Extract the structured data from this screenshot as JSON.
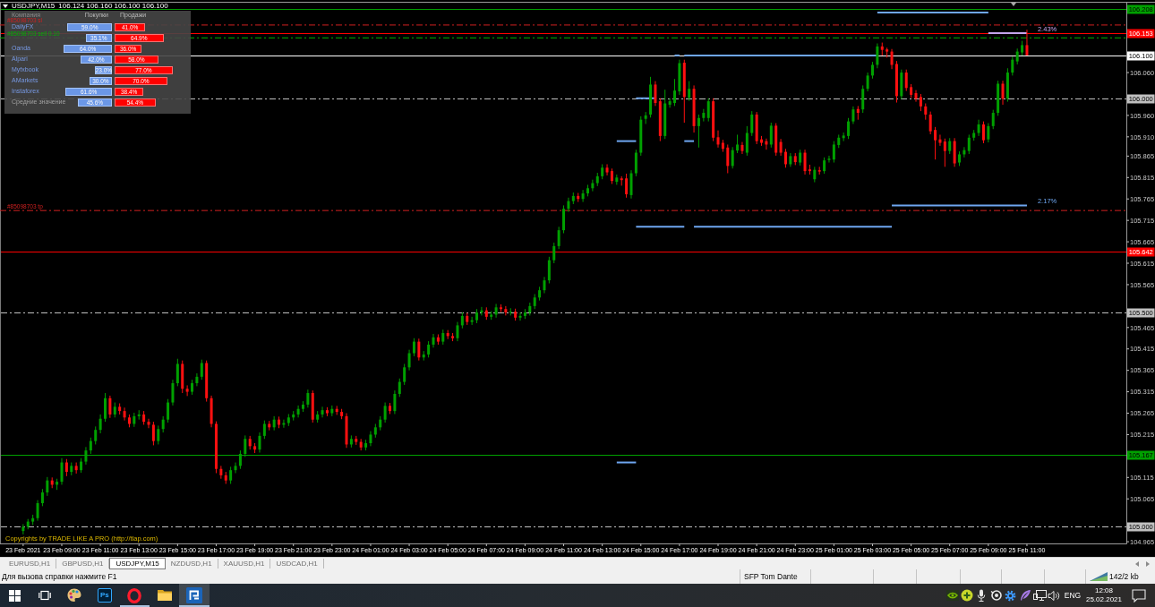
{
  "chart_window": {
    "title": "USDJPY,M15",
    "quote": "106.124 106.160 106.100 106.100",
    "sentiment": {
      "headers": [
        "Компания",
        "Покупки",
        "Продажи"
      ],
      "rows": [
        {
          "kind": "broker",
          "company": "DailyFX",
          "buy": "59.0%",
          "sell": "41.0%"
        },
        {
          "kind": "broker",
          "buy": "35.1%",
          "sell": "64.9%"
        },
        {
          "kind": "broker",
          "company": "Oanda",
          "buy": "64.0%",
          "sell": "36.0%"
        },
        {
          "kind": "broker",
          "company": "Alpari",
          "buy": "42.0%",
          "sell": "58.0%"
        },
        {
          "kind": "broker",
          "company": "Myfxbook",
          "buy": "23.0%",
          "sell": "77.0%"
        },
        {
          "kind": "broker",
          "company": "AMarkets",
          "buy": "30.0%",
          "sell": "70.0%"
        },
        {
          "kind": "broker",
          "company": "Instaforex",
          "buy": "61.6%",
          "sell": "38.4%"
        },
        {
          "kind": "average",
          "company": "Средние значение",
          "buy": "45.6%",
          "sell": "54.4%"
        }
      ]
    },
    "copyright": "Copyrights by TRADE LIKE A PRO (http://tlap.com)",
    "chart_data": {
      "type": "candlestick",
      "x": [
        "2021-02-23T07:00",
        "2021-02-23T07:15",
        "2021-02-23T07:30",
        "2021-02-23T07:45",
        "2021-02-23T08:00",
        "2021-02-23T08:15",
        "2021-02-23T08:30",
        "2021-02-23T08:45",
        "2021-02-23T09:00",
        "2021-02-23T09:15",
        "2021-02-23T09:30",
        "2021-02-23T09:45",
        "2021-02-23T10:00",
        "2021-02-23T10:15",
        "2021-02-23T10:30",
        "2021-02-23T10:45",
        "2021-02-23T11:00",
        "2021-02-23T11:15",
        "2021-02-23T11:30",
        "2021-02-23T11:45",
        "2021-02-23T12:00",
        "2021-02-23T12:15",
        "2021-02-23T12:30",
        "2021-02-23T12:45",
        "2021-02-23T13:00",
        "2021-02-23T13:15",
        "2021-02-23T13:30",
        "2021-02-23T13:45",
        "2021-02-23T14:00",
        "2021-02-23T14:15",
        "2021-02-23T14:30",
        "2021-02-23T14:45",
        "2021-02-23T15:00",
        "2021-02-23T15:15",
        "2021-02-23T15:30",
        "2021-02-23T15:45",
        "2021-02-23T16:00",
        "2021-02-23T16:15",
        "2021-02-23T16:30",
        "2021-02-23T16:45",
        "2021-02-23T17:00",
        "2021-02-23T17:15",
        "2021-02-23T17:30",
        "2021-02-23T17:45",
        "2021-02-23T18:00",
        "2021-02-23T18:15",
        "2021-02-23T18:30",
        "2021-02-23T18:45",
        "2021-02-23T19:00",
        "2021-02-23T19:15",
        "2021-02-23T19:30",
        "2021-02-23T19:45",
        "2021-02-23T20:00",
        "2021-02-23T20:15",
        "2021-02-23T20:30",
        "2021-02-23T20:45",
        "2021-02-23T21:00",
        "2021-02-23T21:15",
        "2021-02-23T21:30",
        "2021-02-23T21:45",
        "2021-02-23T22:00",
        "2021-02-23T22:15",
        "2021-02-23T22:30",
        "2021-02-23T22:45",
        "2021-02-23T23:00",
        "2021-02-23T23:15",
        "2021-02-23T23:30",
        "2021-02-23T23:45",
        "2021-02-24T00:00",
        "2021-02-24T00:15",
        "2021-02-24T00:30",
        "2021-02-24T00:45",
        "2021-02-24T01:00",
        "2021-02-24T01:15",
        "2021-02-24T01:30",
        "2021-02-24T01:45",
        "2021-02-24T02:00",
        "2021-02-24T02:15",
        "2021-02-24T02:30",
        "2021-02-24T02:45",
        "2021-02-24T03:00",
        "2021-02-24T03:15",
        "2021-02-24T03:30",
        "2021-02-24T03:45",
        "2021-02-24T04:00",
        "2021-02-24T04:15",
        "2021-02-24T04:30",
        "2021-02-24T04:45",
        "2021-02-24T05:00",
        "2021-02-24T05:15",
        "2021-02-24T05:30",
        "2021-02-24T05:45",
        "2021-02-24T06:00",
        "2021-02-24T06:15",
        "2021-02-24T06:30",
        "2021-02-24T06:45",
        "2021-02-24T07:00",
        "2021-02-24T07:15",
        "2021-02-24T07:30",
        "2021-02-24T07:45",
        "2021-02-24T08:00",
        "2021-02-24T08:15",
        "2021-02-24T08:30",
        "2021-02-24T08:45",
        "2021-02-24T09:00",
        "2021-02-24T09:15",
        "2021-02-24T09:30",
        "2021-02-24T09:45",
        "2021-02-24T10:00",
        "2021-02-24T10:15",
        "2021-02-24T10:30",
        "2021-02-24T10:45",
        "2021-02-24T11:00",
        "2021-02-24T11:15",
        "2021-02-24T11:30",
        "2021-02-24T11:45",
        "2021-02-24T12:00",
        "2021-02-24T12:15",
        "2021-02-24T12:30",
        "2021-02-24T12:45",
        "2021-02-24T13:00",
        "2021-02-24T13:15",
        "2021-02-24T13:30",
        "2021-02-24T13:45",
        "2021-02-24T14:00",
        "2021-02-24T14:15",
        "2021-02-24T14:30",
        "2021-02-24T14:45",
        "2021-02-24T15:00",
        "2021-02-24T15:15",
        "2021-02-24T15:30",
        "2021-02-24T15:45",
        "2021-02-24T16:00",
        "2021-02-24T16:15",
        "2021-02-24T16:30",
        "2021-02-24T16:45",
        "2021-02-24T17:00",
        "2021-02-24T17:15",
        "2021-02-24T17:30",
        "2021-02-24T17:45",
        "2021-02-24T18:00",
        "2021-02-24T18:15",
        "2021-02-24T18:30",
        "2021-02-24T18:45",
        "2021-02-24T19:00",
        "2021-02-24T19:15",
        "2021-02-24T19:30",
        "2021-02-24T19:45",
        "2021-02-24T20:00",
        "2021-02-24T20:15",
        "2021-02-24T20:30",
        "2021-02-24T20:45",
        "2021-02-24T21:00",
        "2021-02-24T21:15",
        "2021-02-24T21:30",
        "2021-02-24T21:45",
        "2021-02-24T22:00",
        "2021-02-24T22:15",
        "2021-02-24T22:30",
        "2021-02-24T22:45",
        "2021-02-24T23:00",
        "2021-02-24T23:15",
        "2021-02-24T23:30",
        "2021-02-24T23:45",
        "2021-02-25T00:00",
        "2021-02-25T00:15",
        "2021-02-25T00:30",
        "2021-02-25T00:45",
        "2021-02-25T01:00",
        "2021-02-25T01:15",
        "2021-02-25T01:30",
        "2021-02-25T01:45",
        "2021-02-25T02:00",
        "2021-02-25T02:15",
        "2021-02-25T02:30",
        "2021-02-25T02:45",
        "2021-02-25T03:00",
        "2021-02-25T03:15",
        "2021-02-25T03:30",
        "2021-02-25T03:45",
        "2021-02-25T04:00",
        "2021-02-25T04:15",
        "2021-02-25T04:30",
        "2021-02-25T04:45",
        "2021-02-25T05:00",
        "2021-02-25T05:15",
        "2021-02-25T05:30",
        "2021-02-25T05:45",
        "2021-02-25T06:00",
        "2021-02-25T06:15",
        "2021-02-25T06:30",
        "2021-02-25T06:45",
        "2021-02-25T07:00",
        "2021-02-25T07:15",
        "2021-02-25T07:30",
        "2021-02-25T07:45",
        "2021-02-25T08:00",
        "2021-02-25T08:15",
        "2021-02-25T08:30",
        "2021-02-25T08:45",
        "2021-02-25T09:00",
        "2021-02-25T09:15",
        "2021-02-25T09:30",
        "2021-02-25T09:45",
        "2021-02-25T10:00",
        "2021-02-25T10:15",
        "2021-02-25T10:30",
        "2021-02-25T10:45",
        "2021-02-25T11:00"
      ],
      "ohlc": [
        [
          104.99,
          105.006,
          104.982,
          105.0
        ],
        [
          105.0,
          105.018,
          104.994,
          105.012
        ],
        [
          105.012,
          105.028,
          105.004,
          105.02
        ],
        [
          105.02,
          105.062,
          105.014,
          105.055
        ],
        [
          105.055,
          105.088,
          105.048,
          105.08
        ],
        [
          105.08,
          105.116,
          105.072,
          105.108
        ],
        [
          105.108,
          105.115,
          105.09,
          105.098
        ],
        [
          105.098,
          105.112,
          105.086,
          105.105
        ],
        [
          105.105,
          105.16,
          105.098,
          105.15
        ],
        [
          105.15,
          105.158,
          105.118,
          105.128
        ],
        [
          105.128,
          105.15,
          105.12,
          105.142
        ],
        [
          105.142,
          105.15,
          105.124,
          105.132
        ],
        [
          105.132,
          105.16,
          105.126,
          105.152
        ],
        [
          105.152,
          105.186,
          105.145,
          105.178
        ],
        [
          105.178,
          105.208,
          105.17,
          105.2
        ],
        [
          105.2,
          105.234,
          105.192,
          105.226
        ],
        [
          105.226,
          105.262,
          105.218,
          105.252
        ],
        [
          105.252,
          105.312,
          105.245,
          105.3
        ],
        [
          105.3,
          105.306,
          105.254,
          105.262
        ],
        [
          105.262,
          105.29,
          105.255,
          105.28
        ],
        [
          105.28,
          105.288,
          105.262,
          105.27
        ],
        [
          105.27,
          105.278,
          105.248,
          105.255
        ],
        [
          105.255,
          105.262,
          105.232,
          105.24
        ],
        [
          105.24,
          105.266,
          105.233,
          105.258
        ],
        [
          105.258,
          105.272,
          105.25,
          105.262
        ],
        [
          105.262,
          105.27,
          105.238,
          105.245
        ],
        [
          105.245,
          105.252,
          105.23,
          105.238
        ],
        [
          105.238,
          105.245,
          105.19,
          105.2
        ],
        [
          105.2,
          105.236,
          105.192,
          105.228
        ],
        [
          105.228,
          105.258,
          105.22,
          105.25
        ],
        [
          105.25,
          105.298,
          105.243,
          105.29
        ],
        [
          105.29,
          105.343,
          105.283,
          105.335
        ],
        [
          105.335,
          105.392,
          105.328,
          105.38
        ],
        [
          105.38,
          105.388,
          105.312,
          105.322
        ],
        [
          105.322,
          105.33,
          105.305,
          105.315
        ],
        [
          105.315,
          105.343,
          105.308,
          105.335
        ],
        [
          105.335,
          105.358,
          105.328,
          105.35
        ],
        [
          105.35,
          105.39,
          105.343,
          105.382
        ],
        [
          105.382,
          105.388,
          105.292,
          105.3
        ],
        [
          105.3,
          105.306,
          105.232,
          105.24
        ],
        [
          105.24,
          105.246,
          105.125,
          105.135
        ],
        [
          105.135,
          105.142,
          105.112,
          105.12
        ],
        [
          105.12,
          105.128,
          105.1,
          105.108
        ],
        [
          105.108,
          105.14,
          105.1,
          105.132
        ],
        [
          105.132,
          105.15,
          105.125,
          105.142
        ],
        [
          105.142,
          105.178,
          105.135,
          105.17
        ],
        [
          105.17,
          105.213,
          105.163,
          105.205
        ],
        [
          105.205,
          105.212,
          105.18,
          105.188
        ],
        [
          105.188,
          105.195,
          105.172,
          105.18
        ],
        [
          105.18,
          105.22,
          105.173,
          105.212
        ],
        [
          105.212,
          105.248,
          105.205,
          105.24
        ],
        [
          105.24,
          105.247,
          105.225,
          105.232
        ],
        [
          105.232,
          105.258,
          105.225,
          105.25
        ],
        [
          105.25,
          105.257,
          105.23,
          105.238
        ],
        [
          105.238,
          105.25,
          105.231,
          105.242
        ],
        [
          105.242,
          105.263,
          105.235,
          105.255
        ],
        [
          105.255,
          105.27,
          105.248,
          105.262
        ],
        [
          105.262,
          105.283,
          105.255,
          105.275
        ],
        [
          105.275,
          105.293,
          105.268,
          105.285
        ],
        [
          105.285,
          105.32,
          105.278,
          105.312
        ],
        [
          105.312,
          105.318,
          105.243,
          105.25
        ],
        [
          105.25,
          105.27,
          105.243,
          105.262
        ],
        [
          105.262,
          105.28,
          105.255,
          105.272
        ],
        [
          105.272,
          105.279,
          105.258,
          105.265
        ],
        [
          105.265,
          105.283,
          105.258,
          105.275
        ],
        [
          105.275,
          105.282,
          105.261,
          105.268
        ],
        [
          105.268,
          105.275,
          105.251,
          105.258
        ],
        [
          105.258,
          105.265,
          105.184,
          105.192
        ],
        [
          105.192,
          105.213,
          105.185,
          105.205
        ],
        [
          105.205,
          105.212,
          105.191,
          105.198
        ],
        [
          105.198,
          105.205,
          105.178,
          105.185
        ],
        [
          105.185,
          105.203,
          105.178,
          105.195
        ],
        [
          105.195,
          105.223,
          105.188,
          105.215
        ],
        [
          105.215,
          105.24,
          105.208,
          105.232
        ],
        [
          105.232,
          105.258,
          105.225,
          105.25
        ],
        [
          105.25,
          105.29,
          105.243,
          105.282
        ],
        [
          105.282,
          105.289,
          105.263,
          105.27
        ],
        [
          105.27,
          105.318,
          105.263,
          105.31
        ],
        [
          105.31,
          105.346,
          105.303,
          105.338
        ],
        [
          105.338,
          105.38,
          105.331,
          105.372
        ],
        [
          105.372,
          105.413,
          105.365,
          105.405
        ],
        [
          105.405,
          105.44,
          105.398,
          105.432
        ],
        [
          105.432,
          105.439,
          105.388,
          105.395
        ],
        [
          105.395,
          105.41,
          105.388,
          105.402
        ],
        [
          105.402,
          105.433,
          105.395,
          105.425
        ],
        [
          105.425,
          105.45,
          105.418,
          105.442
        ],
        [
          105.442,
          105.449,
          105.425,
          105.432
        ],
        [
          105.432,
          105.46,
          105.425,
          105.452
        ],
        [
          105.452,
          105.459,
          105.438,
          105.445
        ],
        [
          105.445,
          105.452,
          105.433,
          105.44
        ],
        [
          105.44,
          105.478,
          105.433,
          105.47
        ],
        [
          105.47,
          105.5,
          105.463,
          105.492
        ],
        [
          105.492,
          105.499,
          105.471,
          105.478
        ],
        [
          105.478,
          105.49,
          105.471,
          105.482
        ],
        [
          105.482,
          105.508,
          105.475,
          105.5
        ],
        [
          105.5,
          105.513,
          105.493,
          105.505
        ],
        [
          105.505,
          105.512,
          105.483,
          105.49
        ],
        [
          105.49,
          105.503,
          105.483,
          105.495
        ],
        [
          105.495,
          105.52,
          105.488,
          105.512
        ],
        [
          105.512,
          105.519,
          105.501,
          105.508
        ],
        [
          105.508,
          105.515,
          105.493,
          105.5
        ],
        [
          105.5,
          105.51,
          105.493,
          105.502
        ],
        [
          105.502,
          105.509,
          105.481,
          105.488
        ],
        [
          105.488,
          105.5,
          105.481,
          105.492
        ],
        [
          105.492,
          105.508,
          105.485,
          105.5
        ],
        [
          105.5,
          105.523,
          105.493,
          105.515
        ],
        [
          105.515,
          105.543,
          105.508,
          105.535
        ],
        [
          105.535,
          105.56,
          105.528,
          105.552
        ],
        [
          105.552,
          105.583,
          105.545,
          105.575
        ],
        [
          105.575,
          105.63,
          105.568,
          105.622
        ],
        [
          105.622,
          105.663,
          105.615,
          105.655
        ],
        [
          105.655,
          105.7,
          105.648,
          105.692
        ],
        [
          105.692,
          105.75,
          105.685,
          105.742
        ],
        [
          105.742,
          105.768,
          105.735,
          105.76
        ],
        [
          105.76,
          105.78,
          105.753,
          105.772
        ],
        [
          105.772,
          105.779,
          105.758,
          105.765
        ],
        [
          105.765,
          105.786,
          105.758,
          105.778
        ],
        [
          105.778,
          105.798,
          105.771,
          105.79
        ],
        [
          105.79,
          105.81,
          105.783,
          105.802
        ],
        [
          105.802,
          105.826,
          105.795,
          105.818
        ],
        [
          105.818,
          105.846,
          105.811,
          105.838
        ],
        [
          105.838,
          105.846,
          105.82,
          105.827
        ],
        [
          105.83,
          105.836,
          105.8,
          105.807
        ],
        [
          105.805,
          105.822,
          105.798,
          105.815
        ],
        [
          105.813,
          105.818,
          105.796,
          105.809
        ],
        [
          105.813,
          105.824,
          105.768,
          105.776
        ],
        [
          105.774,
          105.832,
          105.766,
          105.825
        ],
        [
          105.825,
          105.88,
          105.818,
          105.873
        ],
        [
          105.873,
          105.958,
          105.866,
          105.95
        ],
        [
          105.952,
          105.968,
          105.94,
          105.96
        ],
        [
          105.962,
          106.05,
          105.955,
          106.032
        ],
        [
          106.032,
          106.04,
          105.982,
          105.989
        ],
        [
          105.993,
          106.0,
          105.9,
          105.912
        ],
        [
          105.912,
          106.02,
          105.905,
          105.988
        ],
        [
          105.985,
          106.0,
          105.978,
          105.993
        ],
        [
          105.989,
          106.045,
          105.982,
          106.018
        ],
        [
          106.016,
          106.09,
          106.008,
          106.082
        ],
        [
          106.083,
          106.09,
          105.943,
          106.003
        ],
        [
          106.001,
          106.04,
          105.994,
          106.022
        ],
        [
          106.022,
          106.03,
          105.92,
          105.935
        ],
        [
          105.935,
          105.962,
          105.885,
          105.954
        ],
        [
          105.954,
          105.975,
          105.946,
          105.966
        ],
        [
          105.954,
          106.0,
          105.946,
          105.993
        ],
        [
          105.993,
          106.0,
          105.9,
          105.908
        ],
        [
          105.909,
          105.925,
          105.885,
          105.892
        ],
        [
          105.896,
          105.903,
          105.875,
          105.882
        ],
        [
          105.885,
          105.892,
          105.825,
          105.842
        ],
        [
          105.842,
          105.886,
          105.836,
          105.879
        ],
        [
          105.878,
          105.915,
          105.872,
          105.892
        ],
        [
          105.891,
          105.898,
          105.87,
          105.877
        ],
        [
          105.873,
          105.935,
          105.866,
          105.919
        ],
        [
          105.919,
          105.97,
          105.912,
          105.962
        ],
        [
          105.962,
          105.968,
          105.893,
          105.9
        ],
        [
          105.904,
          105.912,
          105.889,
          105.896
        ],
        [
          105.9,
          105.906,
          105.88,
          105.892
        ],
        [
          105.892,
          105.943,
          105.885,
          105.936
        ],
        [
          105.936,
          105.942,
          105.866,
          105.873
        ],
        [
          105.898,
          105.905,
          105.866,
          105.873
        ],
        [
          105.875,
          105.882,
          105.838,
          105.846
        ],
        [
          105.846,
          105.872,
          105.84,
          105.865
        ],
        [
          105.865,
          105.872,
          105.844,
          105.851
        ],
        [
          105.85,
          105.88,
          105.843,
          105.873
        ],
        [
          105.873,
          105.88,
          105.822,
          105.83
        ],
        [
          105.834,
          105.845,
          105.822,
          105.83
        ],
        [
          105.811,
          105.84,
          105.804,
          105.833
        ],
        [
          105.832,
          105.84,
          105.822,
          105.829
        ],
        [
          105.83,
          105.862,
          105.824,
          105.855
        ],
        [
          105.856,
          105.866,
          105.85,
          105.859
        ],
        [
          105.857,
          105.9,
          105.85,
          105.892
        ],
        [
          105.891,
          105.915,
          105.884,
          105.908
        ],
        [
          105.907,
          105.92,
          105.9,
          105.913
        ],
        [
          105.912,
          105.954,
          105.905,
          105.946
        ],
        [
          105.946,
          105.981,
          105.94,
          105.974
        ],
        [
          105.975,
          105.982,
          105.95,
          105.966
        ],
        [
          105.974,
          106.03,
          105.966,
          106.022
        ],
        [
          106.022,
          106.06,
          106.016,
          106.053
        ],
        [
          106.053,
          106.085,
          106.046,
          106.078
        ],
        [
          106.078,
          106.128,
          106.07,
          106.121
        ],
        [
          106.121,
          106.13,
          106.1,
          106.113
        ],
        [
          106.114,
          106.118,
          106.095,
          106.109
        ],
        [
          106.109,
          106.115,
          106.068,
          106.078
        ],
        [
          106.08,
          106.087,
          105.99,
          106.005
        ],
        [
          106.005,
          106.067,
          105.998,
          106.06
        ],
        [
          106.06,
          106.067,
          106.017,
          106.024
        ],
        [
          106.026,
          106.033,
          106.001,
          106.008
        ],
        [
          106.012,
          106.019,
          105.992,
          105.999
        ],
        [
          106.003,
          106.01,
          105.97,
          105.981
        ],
        [
          105.981,
          105.988,
          105.95,
          105.962
        ],
        [
          105.962,
          105.969,
          105.916,
          105.923
        ],
        [
          105.926,
          105.933,
          105.857,
          105.902
        ],
        [
          105.904,
          105.915,
          105.889,
          105.896
        ],
        [
          105.899,
          105.906,
          105.84,
          105.877
        ],
        [
          105.877,
          105.907,
          105.87,
          105.9
        ],
        [
          105.9,
          105.907,
          105.84,
          105.848
        ],
        [
          105.85,
          105.876,
          105.842,
          105.869
        ],
        [
          105.869,
          105.886,
          105.862,
          105.879
        ],
        [
          105.877,
          105.915,
          105.87,
          105.908
        ],
        [
          105.908,
          105.926,
          105.901,
          105.919
        ],
        [
          105.919,
          105.95,
          105.912,
          105.939
        ],
        [
          105.939,
          105.946,
          105.895,
          105.902
        ],
        [
          105.904,
          105.942,
          105.897,
          105.935
        ],
        [
          105.935,
          105.973,
          105.928,
          105.966
        ],
        [
          105.966,
          106.041,
          105.959,
          106.034
        ],
        [
          106.034,
          106.041,
          105.985,
          105.999
        ],
        [
          105.999,
          106.07,
          105.992,
          106.06
        ],
        [
          106.06,
          106.097,
          106.053,
          106.09
        ],
        [
          106.086,
          106.116,
          106.079,
          106.109
        ],
        [
          106.107,
          106.134,
          106.1,
          106.124
        ],
        [
          106.124,
          106.16,
          106.1,
          106.1
        ]
      ],
      "xlim": [
        "2021-02-23T05:48",
        "2021-02-25T16:09"
      ],
      "xticks": [
        {
          "value": "2021-02-23T07:00",
          "label": "23 Feb 2021"
        },
        {
          "value": "2021-02-23T09:00",
          "label": "23 Feb 09:00"
        },
        {
          "value": "2021-02-23T11:00",
          "label": "23 Feb 11:00"
        },
        {
          "value": "2021-02-23T13:00",
          "label": "23 Feb 13:00"
        },
        {
          "value": "2021-02-23T15:00",
          "label": "23 Feb 15:00"
        },
        {
          "value": "2021-02-23T17:00",
          "label": "23 Feb 17:00"
        },
        {
          "value": "2021-02-23T19:00",
          "label": "23 Feb 19:00"
        },
        {
          "value": "2021-02-23T21:00",
          "label": "23 Feb 21:00"
        },
        {
          "value": "2021-02-23T23:00",
          "label": "23 Feb 23:00"
        },
        {
          "value": "2021-02-24T01:00",
          "label": "24 Feb 01:00"
        },
        {
          "value": "2021-02-24T03:00",
          "label": "24 Feb 03:00"
        },
        {
          "value": "2021-02-24T05:00",
          "label": "24 Feb 05:00"
        },
        {
          "value": "2021-02-24T07:00",
          "label": "24 Feb 07:00"
        },
        {
          "value": "2021-02-24T09:00",
          "label": "24 Feb 09:00"
        },
        {
          "value": "2021-02-24T11:00",
          "label": "24 Feb 11:00"
        },
        {
          "value": "2021-02-24T13:00",
          "label": "24 Feb 13:00"
        },
        {
          "value": "2021-02-24T15:00",
          "label": "24 Feb 15:00"
        },
        {
          "value": "2021-02-24T17:00",
          "label": "24 Feb 17:00"
        },
        {
          "value": "2021-02-24T19:00",
          "label": "24 Feb 19:00"
        },
        {
          "value": "2021-02-24T21:00",
          "label": "24 Feb 21:00"
        },
        {
          "value": "2021-02-24T23:00",
          "label": "24 Feb 23:00"
        },
        {
          "value": "2021-02-25T01:00",
          "label": "25 Feb 01:00"
        },
        {
          "value": "2021-02-25T03:00",
          "label": "25 Feb 03:00"
        },
        {
          "value": "2021-02-25T05:00",
          "label": "25 Feb 05:00"
        },
        {
          "value": "2021-02-25T07:00",
          "label": "25 Feb 07:00"
        },
        {
          "value": "2021-02-25T09:00",
          "label": "25 Feb 09:00"
        },
        {
          "value": "2021-02-25T11:00",
          "label": "25 Feb 11:00"
        }
      ],
      "ylim": [
        104.961,
        106.221
      ],
      "yticks": [
        {
          "value": 106.06,
          "label": "106.060"
        },
        {
          "value": 105.96,
          "label": "105.960"
        },
        {
          "value": 105.91,
          "label": "105.910"
        },
        {
          "value": 105.865,
          "label": "105.865"
        },
        {
          "value": 105.815,
          "label": "105.815"
        },
        {
          "value": 105.765,
          "label": "105.765"
        },
        {
          "value": 105.715,
          "label": "105.715"
        },
        {
          "value": 105.665,
          "label": "105.665"
        },
        {
          "value": 105.615,
          "label": "105.615"
        },
        {
          "value": 105.565,
          "label": "105.565"
        },
        {
          "value": 105.465,
          "label": "105.465"
        },
        {
          "value": 105.415,
          "label": "105.415"
        },
        {
          "value": 105.365,
          "label": "105.365"
        },
        {
          "value": 105.315,
          "label": "105.315"
        },
        {
          "value": 105.265,
          "label": "105.265"
        },
        {
          "value": 105.215,
          "label": "105.215"
        },
        {
          "value": 105.115,
          "label": "105.115"
        },
        {
          "value": 105.065,
          "label": "105.065"
        },
        {
          "value": 104.965,
          "label": "104.965"
        }
      ],
      "ref_lines": [
        {
          "axis": "y",
          "value": 106.208,
          "label": "106.208",
          "color": "#00a000",
          "line_style": "solid"
        },
        {
          "axis": "y",
          "value": 106.153,
          "label": "106.153",
          "color": "#ff0000",
          "line_style": "solid"
        },
        {
          "axis": "y",
          "value": 106.1,
          "label": "106.100",
          "color": "#ffffff",
          "line_style": "solid"
        },
        {
          "axis": "y",
          "value": 106.0,
          "label": "106.000",
          "color": "#c0c0c0",
          "line_style": "dashdot"
        },
        {
          "axis": "y",
          "value": 105.642,
          "label": "105.642",
          "color": "#ff0000",
          "line_style": "solid"
        },
        {
          "axis": "y",
          "value": 105.5,
          "label": "105.500",
          "color": "#c0c0c0",
          "line_style": "dashdot"
        },
        {
          "axis": "y",
          "value": 105.167,
          "label": "105.167",
          "color": "#00a000",
          "line_style": "solid"
        },
        {
          "axis": "y",
          "value": 105.0,
          "label": "105.000",
          "color": "#c0c0c0",
          "line_style": "dashdot"
        }
      ],
      "series": [
        {
          "name": "#85098703 sl",
          "type": "line",
          "x": [
            "2021-02-23T05:48",
            "2021-02-25T16:09"
          ],
          "values": [
            106.171,
            106.171
          ],
          "color": "#d02020",
          "line_style": "dashdot"
        },
        {
          "name": "#85098703 sell 0.10",
          "type": "line",
          "x": [
            "2021-02-23T05:48",
            "2021-02-25T16:09"
          ],
          "values": [
            106.141,
            106.141
          ],
          "color": "#00b000",
          "line_style": "dashdot"
        },
        {
          "name": "#85098703 tp",
          "type": "line",
          "x": [
            "2021-02-23T05:48",
            "2021-02-25T16:09"
          ],
          "values": [
            105.738,
            105.738
          ],
          "color": "#d02020",
          "line_style": "dashdot"
        },
        {
          "type": "line",
          "x": [
            "2021-02-25T03:15",
            "2021-02-25T09:00"
          ],
          "values": [
            106.2,
            106.2
          ],
          "color": "#6ea6f0"
        },
        {
          "name": "2.43%",
          "type": "line",
          "x": [
            "2021-02-25T09:00",
            "2021-02-25T11:00"
          ],
          "values": [
            106.152,
            106.152
          ],
          "color": "#c4a4ec"
        },
        {
          "type": "line",
          "x": [
            "2021-02-24T16:45",
            "2021-02-24T17:00"
          ],
          "values": [
            106.1,
            106.1
          ],
          "color": "#6ea6f0"
        },
        {
          "type": "line",
          "x": [
            "2021-02-24T17:15",
            "2021-02-25T03:15"
          ],
          "values": [
            106.1,
            106.1
          ],
          "color": "#6ea6f0"
        },
        {
          "type": "line",
          "x": [
            "2021-02-24T14:45",
            "2021-02-24T15:45"
          ],
          "values": [
            106.0,
            106.0
          ],
          "color": "#6ea6f0"
        },
        {
          "type": "line",
          "x": [
            "2021-02-24T13:45",
            "2021-02-24T14:45"
          ],
          "values": [
            105.9,
            105.9
          ],
          "color": "#6ea6f0"
        },
        {
          "type": "line",
          "x": [
            "2021-02-24T17:15",
            "2021-02-24T17:45"
          ],
          "values": [
            105.9,
            105.9
          ],
          "color": "#6ea6f0"
        },
        {
          "name": "2.17%",
          "type": "line",
          "x": [
            "2021-02-25T04:00",
            "2021-02-25T11:00"
          ],
          "values": [
            105.75,
            105.75
          ],
          "color": "#6ea6f0"
        },
        {
          "type": "line",
          "x": [
            "2021-02-24T14:45",
            "2021-02-24T17:15"
          ],
          "values": [
            105.7,
            105.7
          ],
          "color": "#6ea6f0"
        },
        {
          "type": "line",
          "x": [
            "2021-02-24T17:45",
            "2021-02-25T04:00"
          ],
          "values": [
            105.7,
            105.7
          ],
          "color": "#6ea6f0"
        },
        {
          "type": "line",
          "x": [
            "2021-02-24T13:45",
            "2021-02-24T14:45"
          ],
          "values": [
            105.15,
            105.15
          ],
          "color": "#6ea6f0"
        }
      ]
    }
  },
  "tabs": [
    {
      "label": "EURUSD,H1",
      "selected": false
    },
    {
      "label": "GBPUSD,H1",
      "selected": false
    },
    {
      "label": "USDJPY,M15",
      "selected": true
    },
    {
      "label": "NZDUSD,H1",
      "selected": false
    },
    {
      "label": "XAUUSD,H1",
      "selected": false
    },
    {
      "label": "USDCAD,H1",
      "selected": false
    }
  ],
  "status_bar": {
    "help": "Для вызова справки нажмите F1",
    "profile": "SFP Tom Dante",
    "traffic": "142/2 kb"
  },
  "taskbar": {
    "apps": [
      {
        "running": false,
        "selected": false
      },
      {
        "label": "Ps",
        "running": false,
        "selected": false
      },
      {
        "running": true,
        "selected": false
      },
      {
        "running": false,
        "selected": false
      },
      {
        "running": true,
        "selected": true
      }
    ],
    "tray": {
      "language": "ENG",
      "time": "12:08",
      "date": "25.02.2021"
    }
  }
}
